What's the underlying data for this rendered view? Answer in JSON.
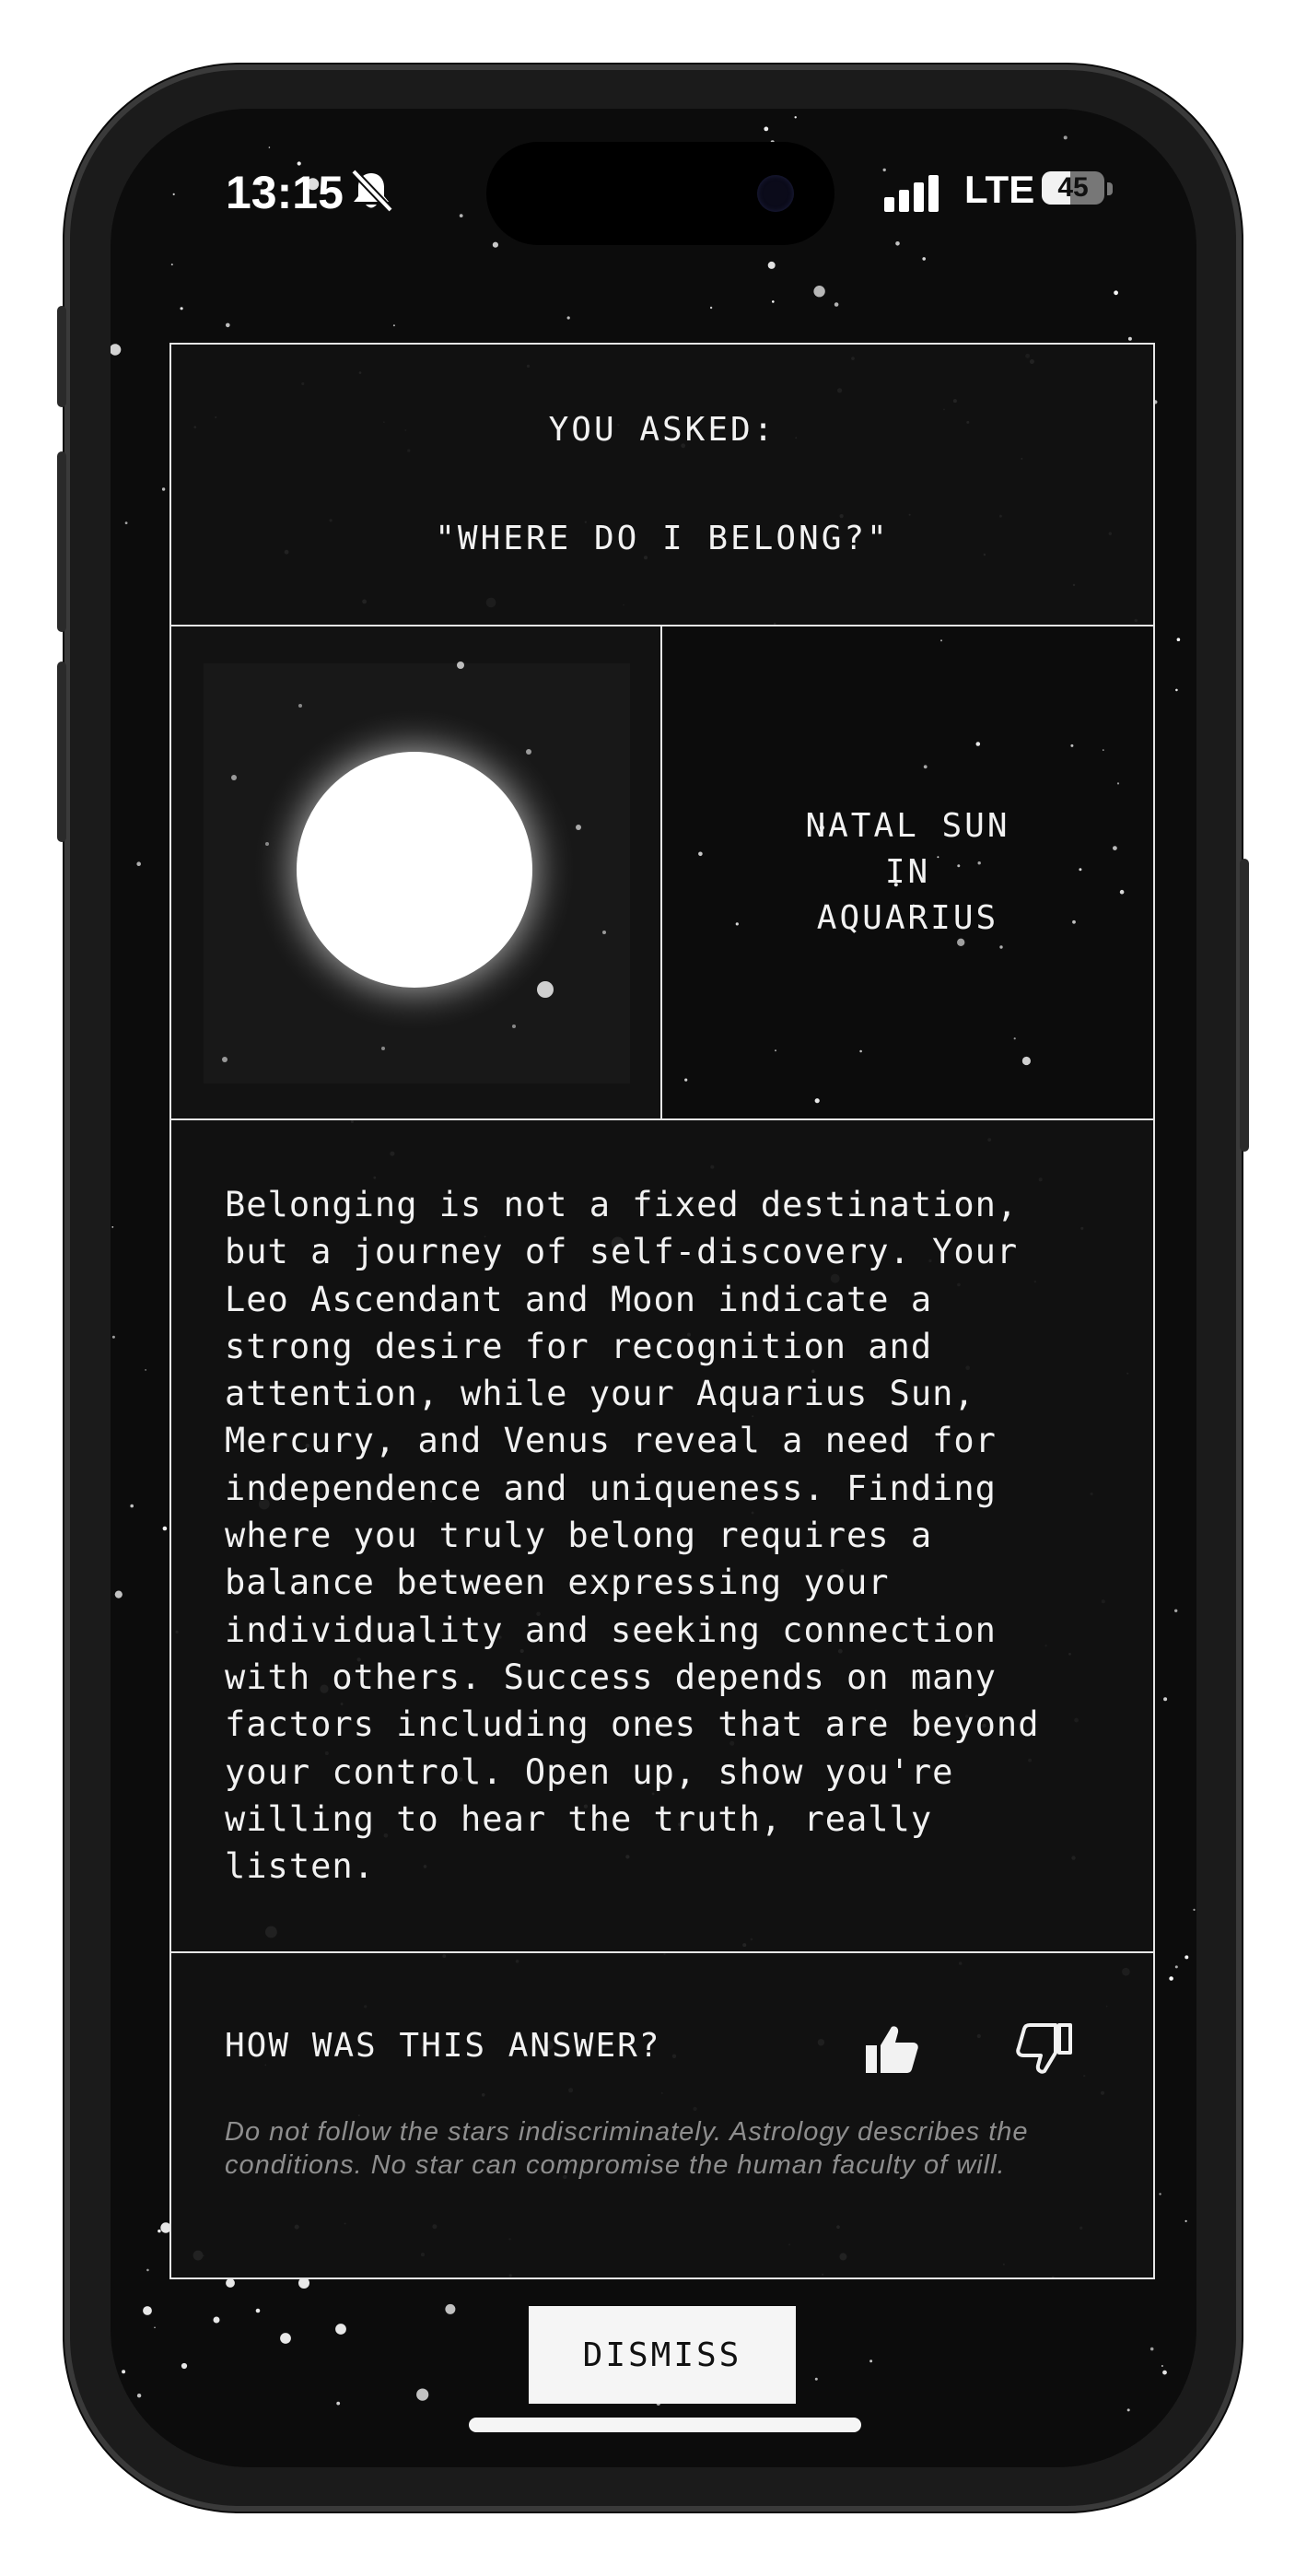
{
  "status_bar": {
    "time": "13:15",
    "network": "LTE",
    "battery_percent": "45",
    "silent_icon": "bell-slash-icon",
    "signal_icon": "signal-bars-icon"
  },
  "reading": {
    "asked_label": "YOU ASKED:",
    "question": "\"WHERE DO I BELONG?\"",
    "placement": "NATAL SUN IN AQUARIUS",
    "planet_icon": "sun-planet-image",
    "answer": "Belonging is not a fixed destination,\nbut a journey of self-discovery. Your\nLeo Ascendant and Moon indicate a\nstrong desire for recognition and\nattention, while your Aquarius Sun,\nMercury, and Venus reveal a need for\nindependence and uniqueness. Finding\nwhere you truly belong requires a\nbalance between expressing your\nindividuality and seeking connection\nwith others. Success depends on many\nfactors including ones that are beyond\nyour control. Open up, show you're\nwilling to hear the truth, really\nlisten."
  },
  "feedback": {
    "question": "HOW WAS THIS ANSWER?",
    "thumbs_up_icon": "thumbs-up-icon",
    "thumbs_down_icon": "thumbs-down-icon",
    "thumbs_up_selected": true,
    "disclaimer": "Do not follow the stars indiscriminately. Astrology describes the conditions. No star can compromise the human faculty of will."
  },
  "actions": {
    "dismiss_label": "DISMISS"
  },
  "colors": {
    "background": "#0c0c0c",
    "panel": "#121212",
    "border": "#e6e6e6",
    "text": "#f2f2f2",
    "muted_text": "#8e8e8e",
    "button": "#f5f5f5"
  }
}
